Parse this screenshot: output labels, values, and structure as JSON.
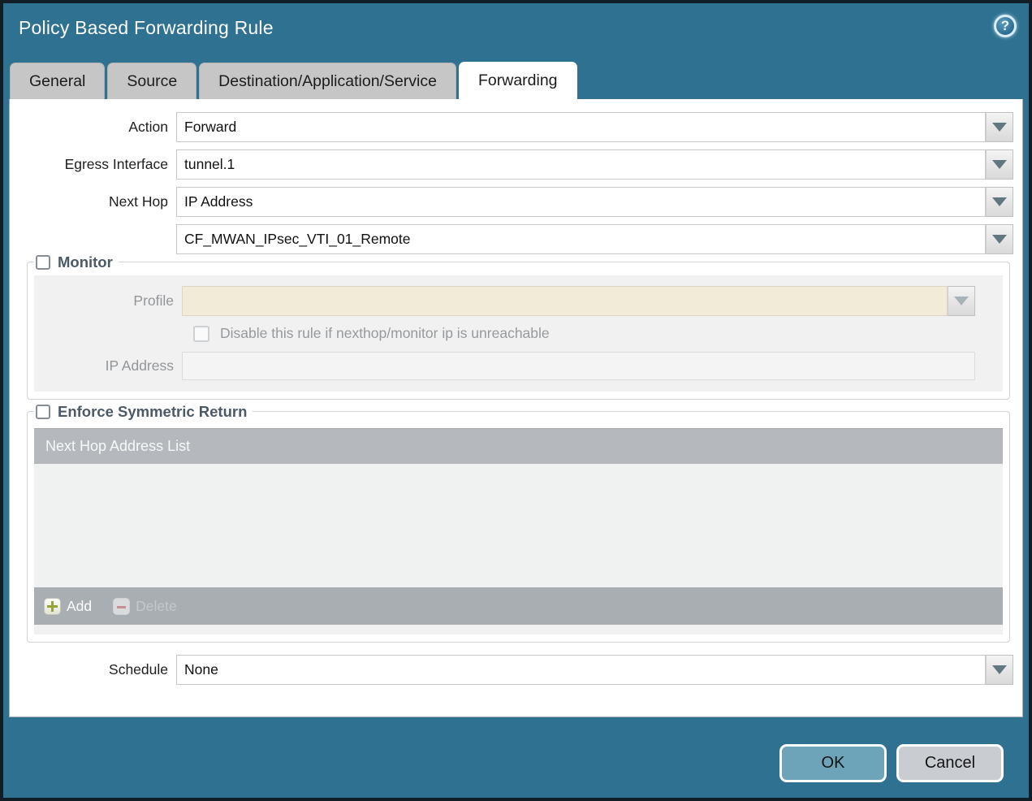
{
  "window": {
    "title": "Policy Based Forwarding Rule",
    "help_icon_glyph": "?"
  },
  "tabs": [
    {
      "label": "General",
      "active": false
    },
    {
      "label": "Source",
      "active": false
    },
    {
      "label": "Destination/Application/Service",
      "active": false
    },
    {
      "label": "Forwarding",
      "active": true
    }
  ],
  "form": {
    "action": {
      "label": "Action",
      "value": "Forward"
    },
    "egress_interface": {
      "label": "Egress Interface",
      "value": "tunnel.1"
    },
    "next_hop": {
      "label": "Next Hop",
      "value": "IP Address"
    },
    "next_hop_address": {
      "value": "CF_MWAN_IPsec_VTI_01_Remote"
    },
    "schedule": {
      "label": "Schedule",
      "value": "None"
    }
  },
  "monitor": {
    "label": "Monitor",
    "checked": false,
    "profile": {
      "label": "Profile",
      "value": ""
    },
    "disable_rule": {
      "label": "Disable this rule if nexthop/monitor ip is unreachable",
      "checked": false
    },
    "ip_address": {
      "label": "IP Address",
      "value": ""
    }
  },
  "enforce_symmetric_return": {
    "label": "Enforce Symmetric Return",
    "checked": false,
    "table": {
      "header": "Next Hop Address List",
      "rows": []
    },
    "add_button": "Add",
    "delete_button": "Delete"
  },
  "footer": {
    "ok": "OK",
    "cancel": "Cancel"
  },
  "colors": {
    "titlebar_teal": "#2E7191",
    "tab_inactive": "#C6C6C6",
    "ok_button": "#6EA4B9",
    "cancel_button": "#C9CDD1",
    "table_header": "#B5B9BD",
    "table_footer": "#A9AEB3",
    "disabled_field_beige": "#F1EBD7",
    "add_plus_green": "#96A437",
    "delete_minus_red": "#C98F94"
  }
}
